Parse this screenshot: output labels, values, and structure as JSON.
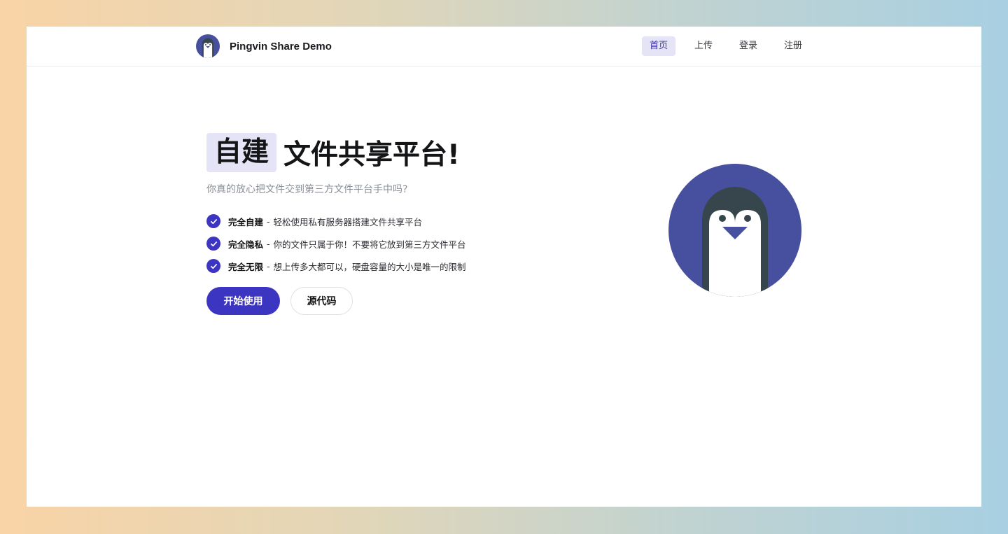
{
  "app": {
    "name": "Pingvin Share Demo",
    "logo_icon": "penguin-logo-icon"
  },
  "nav": {
    "items": [
      {
        "label": "首页",
        "active": true
      },
      {
        "label": "上传",
        "active": false
      },
      {
        "label": "登录",
        "active": false
      },
      {
        "label": "注册",
        "active": false
      }
    ]
  },
  "hero": {
    "title_highlight": "自建",
    "title_rest": "文件共享平台!",
    "subtitle": "你真的放心把文件交到第三方文件平台手中吗?",
    "features": [
      {
        "bold": "完全自建",
        "sep": "-",
        "text": "轻松使用私有服务器搭建文件共享平台"
      },
      {
        "bold": "完全隐私",
        "sep": "-",
        "text": "你的文件只属于你！不要将它放到第三方文件平台"
      },
      {
        "bold": "完全无限",
        "sep": "-",
        "text": "想上传多大都可以，硬盘容量的大小是唯一的限制"
      }
    ],
    "primary_button": "开始使用",
    "secondary_button": "源代码"
  },
  "colors": {
    "accent": "#3c35c2",
    "highlight_bg": "#e5e3f6",
    "mascot_circle": "#46509e",
    "mascot_body": "#37464c"
  },
  "icons": {
    "check": "check-icon",
    "mascot": "penguin-mascot-icon"
  }
}
